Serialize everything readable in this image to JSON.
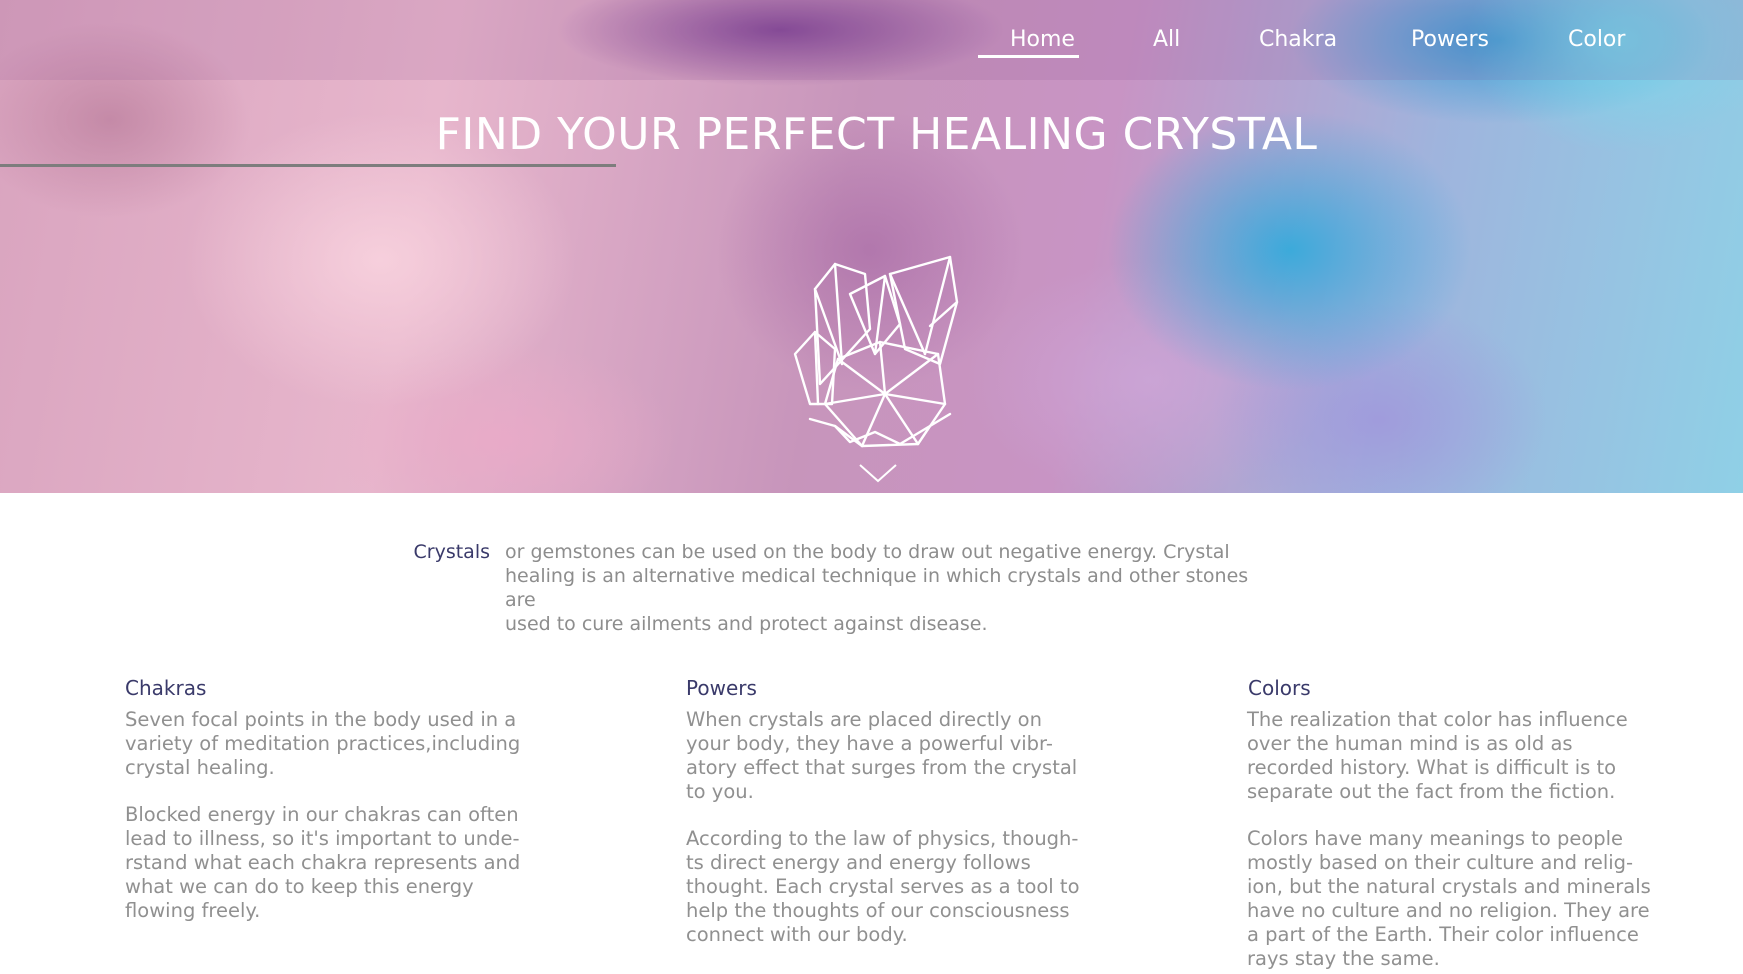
{
  "nav": {
    "items": [
      {
        "label": "Home",
        "active": true
      },
      {
        "label": "All"
      },
      {
        "label": "Chakra"
      },
      {
        "label": "Powers"
      },
      {
        "label": "Color"
      }
    ]
  },
  "hero": {
    "title": "FIND YOUR PERFECT HEALING CRYSTAL",
    "icon": "crystal-cluster-icon",
    "scroll_icon": "chevron-down-icon"
  },
  "intro": {
    "label": "Crystals",
    "text_lines": [
      "or gemstones can be used on the body to draw out negative energy. Crystal",
      "healing is an alternative medical technique in which crystals and other stones are",
      "used to cure ailments and protect against disease."
    ]
  },
  "columns": [
    {
      "title": "Chakras",
      "p1": [
        "Seven focal points in the body used in a",
        "variety of meditation practices,including",
        "crystal healing."
      ],
      "p2": [
        "Blocked energy in our chakras can often",
        "lead to illness, so it's important to unde-",
        "rstand what each chakra represents and",
        "what we can do to keep this energy",
        "flowing freely."
      ]
    },
    {
      "title": "Powers",
      "p1": [
        "When crystals are placed directly on",
        "your body, they have a powerful vibr-",
        "atory effect that surges from the crystal",
        "to you."
      ],
      "p2": [
        "According to the law of physics, though-",
        "ts direct energy and energy follows",
        "thought. Each crystal serves as a tool to",
        "help the thoughts of our consciousness",
        "connect with our body."
      ]
    },
    {
      "title": "Colors",
      "p1": [
        "The realization that color has influence",
        "over the human mind is as old as",
        "recorded history. What is difficult is to",
        "separate out the fact from the fiction."
      ],
      "p2": [
        "Colors have many meanings to people",
        "mostly based on their culture and relig-",
        "ion, but the natural crystals and minerals",
        "have no culture and no religion. They are",
        "a part of the Earth. Their color influence",
        "rays stay the same."
      ]
    }
  ],
  "colors": {
    "heading": "#3a3a6a",
    "body_text": "#8d8d8d",
    "nav_text": "#ffffff"
  }
}
